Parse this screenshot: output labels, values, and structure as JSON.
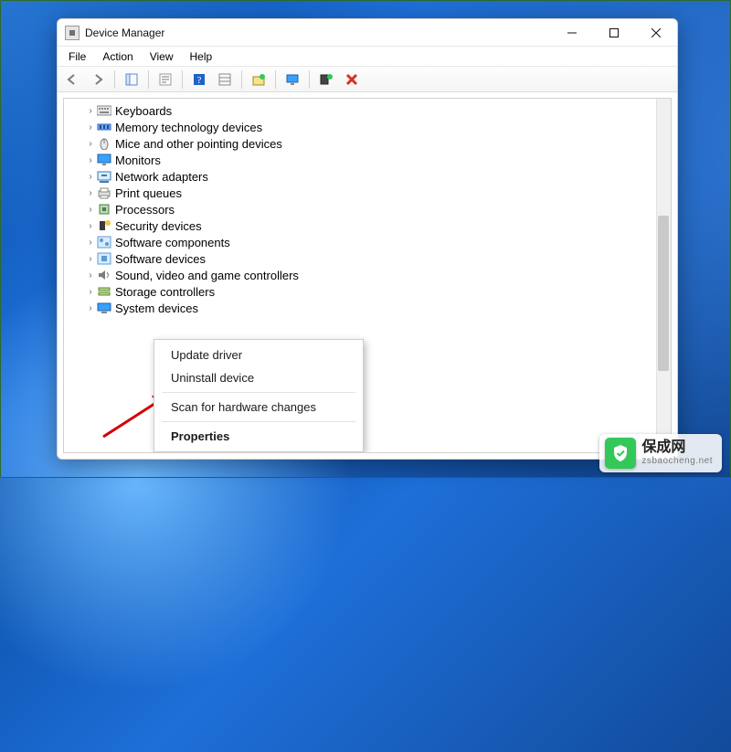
{
  "window": {
    "title": "Device Manager"
  },
  "menubar": {
    "items": [
      "File",
      "Action",
      "View",
      "Help"
    ]
  },
  "toolbar_icons": [
    "back-arrow-icon",
    "forward-arrow-icon",
    "|",
    "show-hide-tree-icon",
    "|",
    "properties-icon",
    "|",
    "help-icon",
    "details-icon",
    "|",
    "scan-hardware-icon",
    "|",
    "monitor-icon",
    "|",
    "add-legacy-icon",
    "delete-icon"
  ],
  "tree": {
    "items": [
      {
        "label": "Keyboards",
        "icon": "keyboard-icon"
      },
      {
        "label": "Memory technology devices",
        "icon": "memory-icon"
      },
      {
        "label": "Mice and other pointing devices",
        "icon": "mouse-icon"
      },
      {
        "label": "Monitors",
        "icon": "monitor-icon"
      },
      {
        "label": "Network adapters",
        "icon": "network-icon"
      },
      {
        "label": "Print queues",
        "icon": "printer-icon"
      },
      {
        "label": "Processors",
        "icon": "cpu-icon"
      },
      {
        "label": "Security devices",
        "icon": "security-icon"
      },
      {
        "label": "Software components",
        "icon": "software-component-icon"
      },
      {
        "label": "Software devices",
        "icon": "software-device-icon"
      },
      {
        "label": "Sound, video and game controllers",
        "icon": "sound-icon"
      },
      {
        "label": "Storage controllers",
        "icon": "storage-icon"
      },
      {
        "label": "System devices",
        "icon": "system-icon"
      }
    ]
  },
  "context_menu": {
    "items": [
      {
        "label": "Update driver",
        "bold": false
      },
      {
        "label": "Uninstall device",
        "bold": false
      },
      {
        "label": "—sep—"
      },
      {
        "label": "Scan for hardware changes",
        "bold": false
      },
      {
        "label": "—sep—"
      },
      {
        "label": "Properties",
        "bold": true
      }
    ]
  },
  "watermark": {
    "name": "保成网",
    "domain": "zsbaocheng.net"
  }
}
